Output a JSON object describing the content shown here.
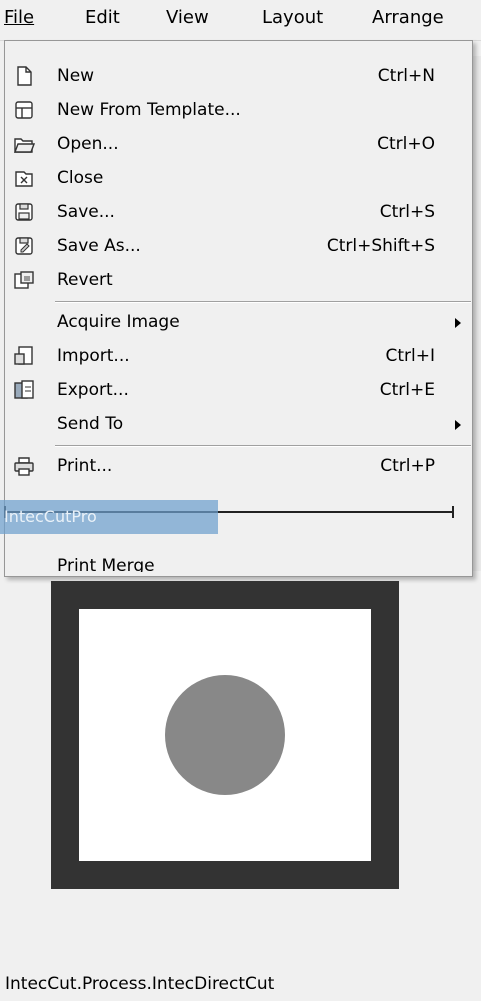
{
  "menubar": {
    "file": "File",
    "edit": "Edit",
    "view": "View",
    "layout": "Layout",
    "arrange": "Arrange"
  },
  "menu": {
    "new": {
      "label": "New",
      "shortcut": "Ctrl+N",
      "icon": "new-document-icon"
    },
    "new_from_template": {
      "label": "New From Template...",
      "icon": "template-icon"
    },
    "open": {
      "label": "Open...",
      "shortcut": "Ctrl+O",
      "icon": "open-folder-icon"
    },
    "close": {
      "label": "Close",
      "icon": "close-document-icon"
    },
    "save": {
      "label": "Save...",
      "shortcut": "Ctrl+S",
      "icon": "save-icon"
    },
    "save_as": {
      "label": "Save As...",
      "shortcut": "Ctrl+Shift+S",
      "icon": "save-as-icon"
    },
    "revert": {
      "label": "Revert",
      "icon": "revert-icon"
    },
    "acquire_image": {
      "label": "Acquire Image"
    },
    "import": {
      "label": "Import...",
      "shortcut": "Ctrl+I",
      "icon": "import-icon"
    },
    "export": {
      "label": "Export...",
      "shortcut": "Ctrl+E",
      "icon": "export-icon"
    },
    "send_to": {
      "label": "Send To"
    },
    "print": {
      "label": "Print...",
      "shortcut": "Ctrl+P",
      "icon": "printer-icon"
    },
    "intec": {
      "label": "IntecCut.Process.IntecDirectCut",
      "icon": "plugin-icon"
    },
    "print_merge": {
      "label": "Print Merge"
    }
  },
  "drag_ghost": {
    "label": "IntecCutPro"
  }
}
